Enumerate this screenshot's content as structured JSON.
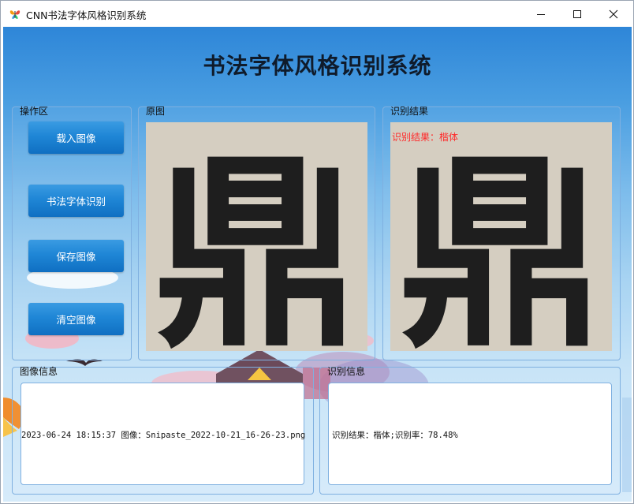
{
  "window": {
    "title": "CNN书法字体风格识别系统",
    "app_icon": "butterfly-icon",
    "controls": [
      "minimize-icon",
      "maximize-icon",
      "close-icon"
    ]
  },
  "header": {
    "title": "书法字体风格识别系统"
  },
  "operation_panel": {
    "label": "操作区",
    "buttons": [
      {
        "label": "载入图像"
      },
      {
        "label": "书法字体识别"
      },
      {
        "label": "保存图像"
      },
      {
        "label": "清空图像"
      }
    ]
  },
  "original_panel": {
    "label": "原图",
    "character": "鼎"
  },
  "result_panel": {
    "label": "识别结果",
    "overlay_text": "识别结果：楷体",
    "character": "鼎"
  },
  "image_info": {
    "label": "图像信息",
    "text": "2023-06-24 18:15:37 图像：Snipaste_2022-10-21_16-26-23.png"
  },
  "recognition_info": {
    "label": "识别信息",
    "text": "识别结果：楷体;识别率：78.48%"
  },
  "colors": {
    "button": "#1f86d6",
    "overlay_text": "#ff2a2a",
    "panel_border": "#7fb0e0",
    "paper": "#d6cfc2"
  }
}
